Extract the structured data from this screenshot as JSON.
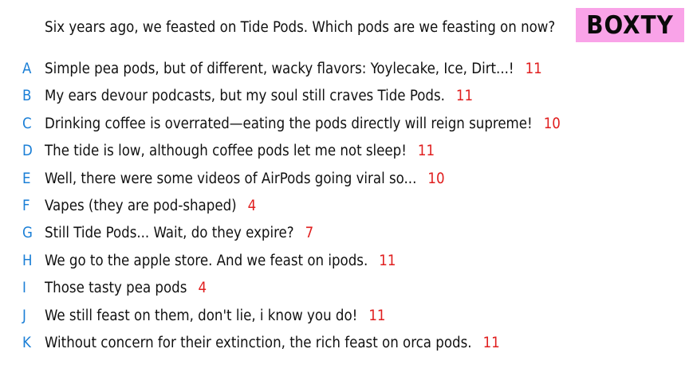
{
  "question": "Six years ago, we feasted on Tide Pods. Which pods are we feasting on now?",
  "badge": {
    "label": "BOXTY",
    "color": "#f9a3e8"
  },
  "colors": {
    "letter": "#1b7fd6",
    "score": "#e01e1e",
    "text": "#111111"
  },
  "answers": [
    {
      "letter": "A",
      "text": "Simple pea pods, but of different, wacky flavors: Yoylecake, Ice, Dirt...!",
      "score": "11"
    },
    {
      "letter": "B",
      "text": "My ears devour podcasts, but my soul still craves Tide Pods.",
      "score": "11"
    },
    {
      "letter": "C",
      "text": "Drinking coffee is overrated—eating the pods directly will reign supreme!",
      "score": "10"
    },
    {
      "letter": "D",
      "text": "The tide is low, although coffee pods let me not sleep!",
      "score": "11"
    },
    {
      "letter": "E",
      "text": "Well, there were some videos of AirPods going viral so...",
      "score": "10"
    },
    {
      "letter": "F",
      "text": "Vapes (they are pod-shaped)",
      "score": "4"
    },
    {
      "letter": "G",
      "text": "Still Tide Pods... Wait, do they expire?",
      "score": "7"
    },
    {
      "letter": "H",
      "text": "We go to the apple store. And we feast on ipods.",
      "score": "11"
    },
    {
      "letter": "I",
      "text": "Those tasty pea pods",
      "score": "4"
    },
    {
      "letter": "J",
      "text": "We still feast on them, don't lie, i know you do!",
      "score": "11"
    },
    {
      "letter": "K",
      "text": "Without concern for their extinction, the rich feast on orca pods.",
      "score": "11"
    }
  ]
}
